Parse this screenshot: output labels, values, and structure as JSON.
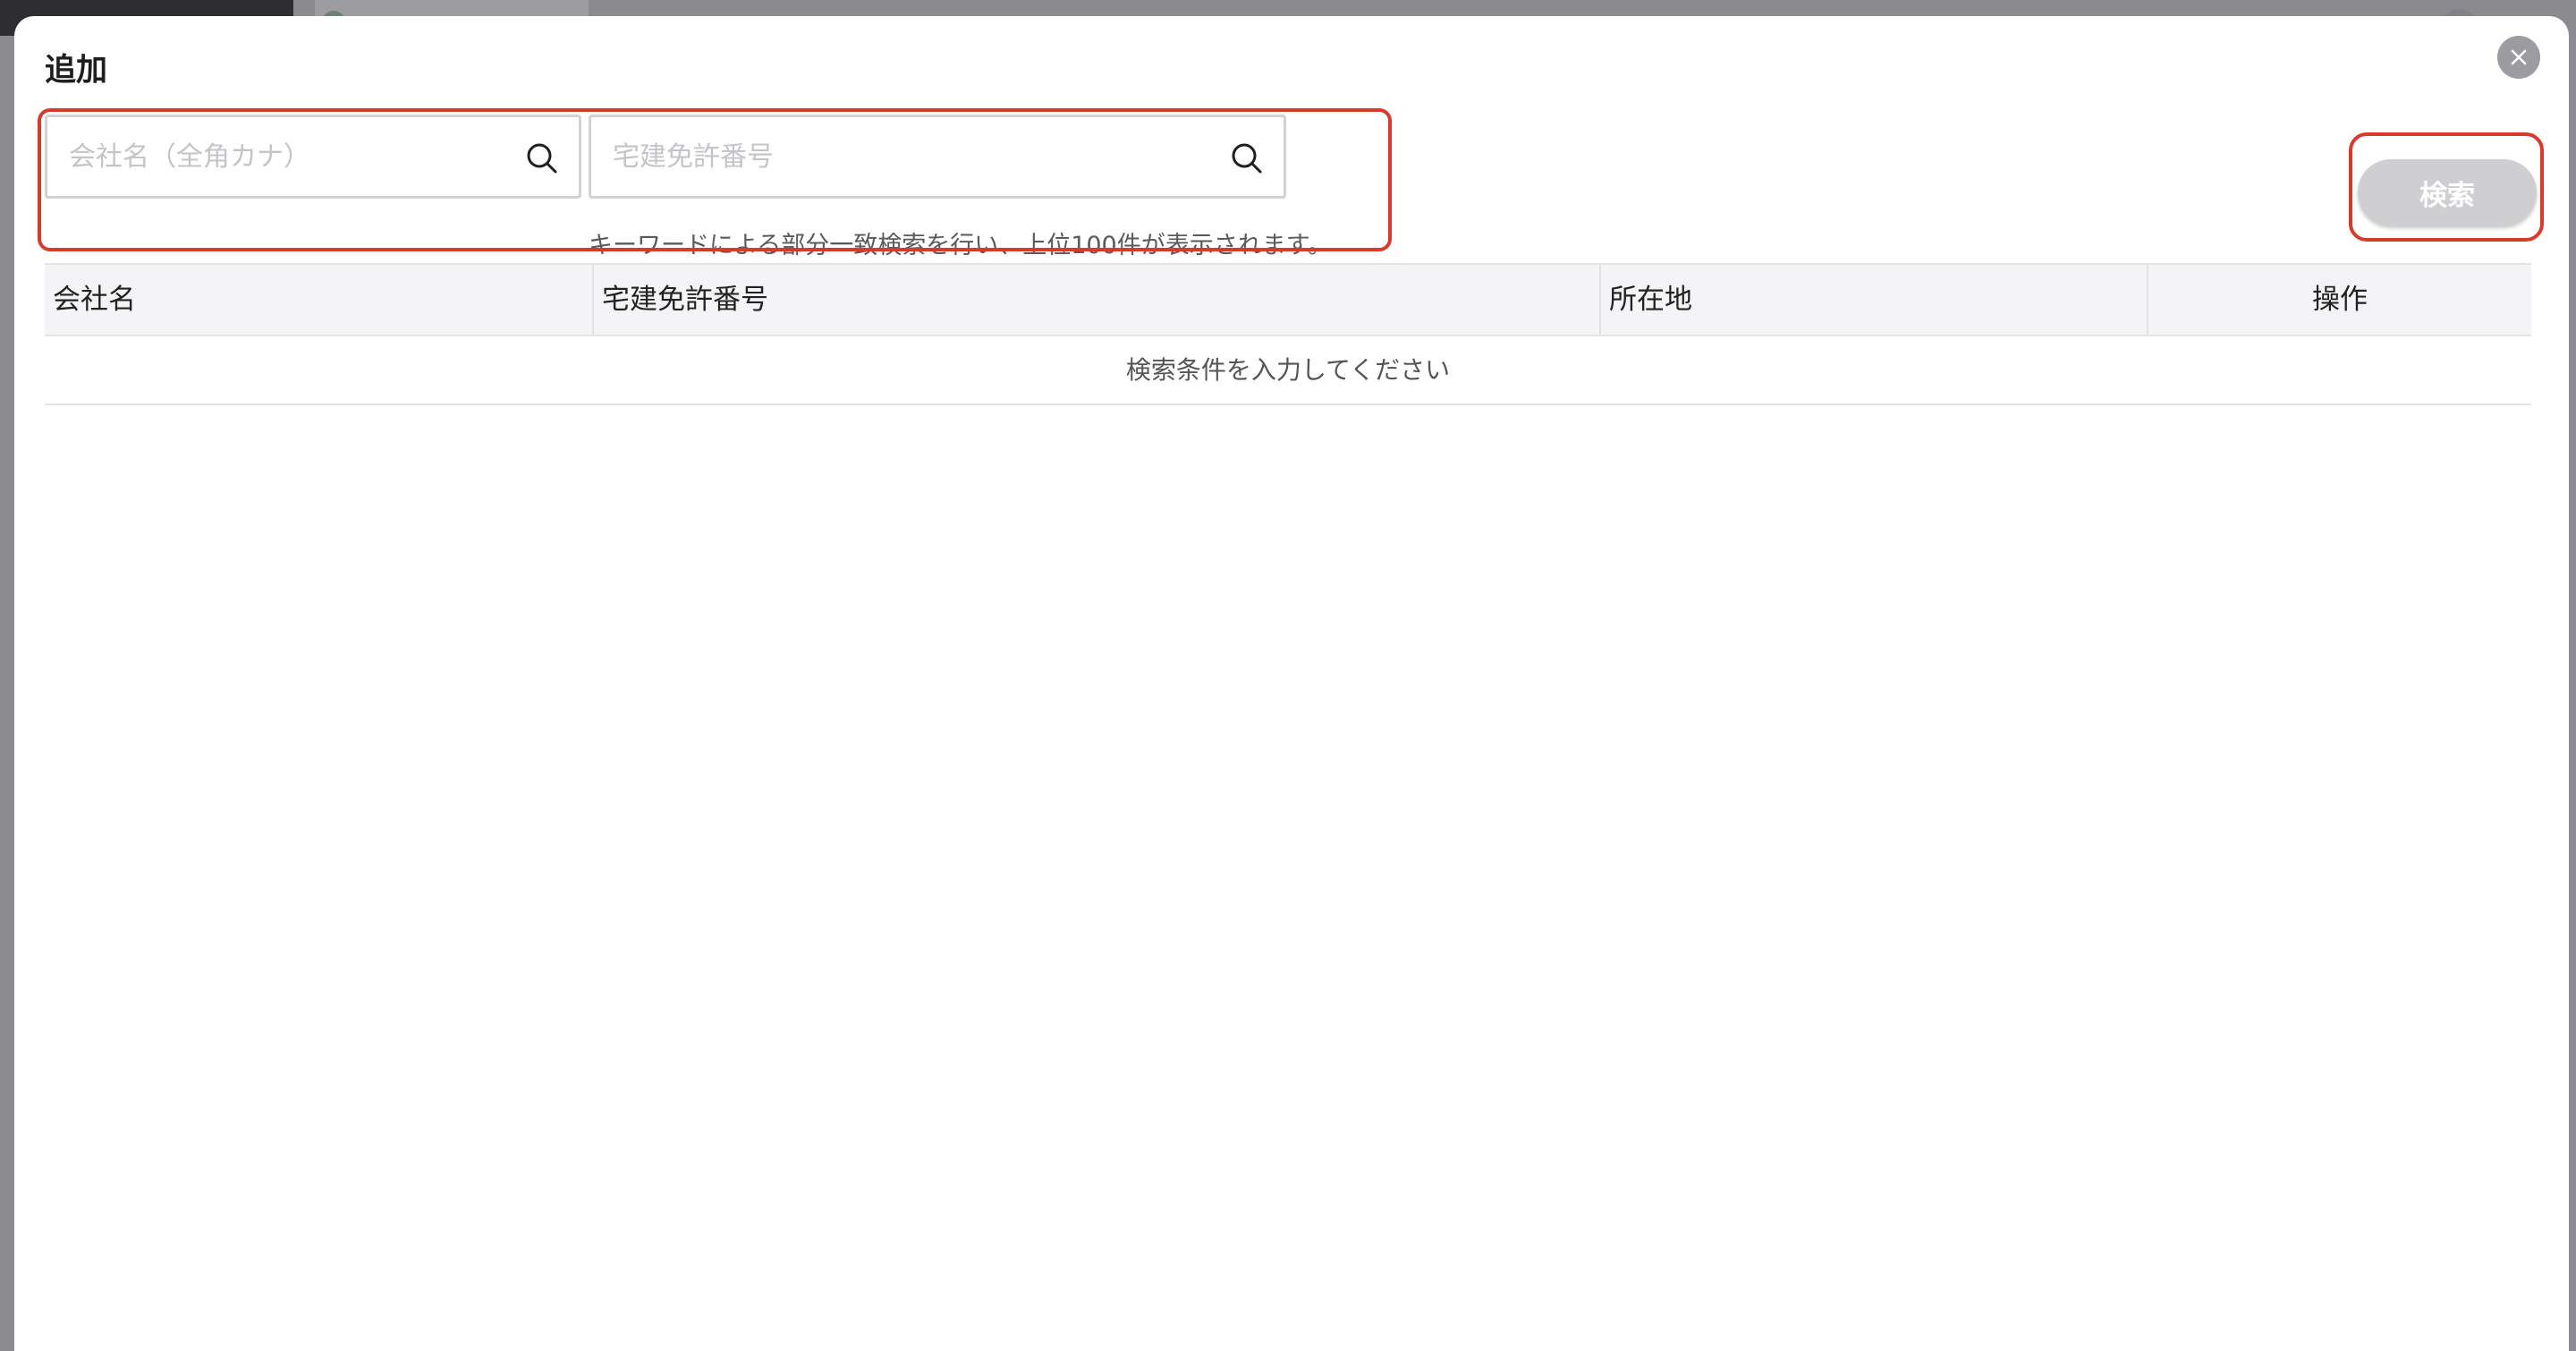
{
  "modal": {
    "title": "追加",
    "close_icon": "close-icon"
  },
  "search": {
    "company_name_placeholder": "会社名（全角カナ）",
    "license_number_placeholder": "宅建免許番号",
    "hint": "キーワードによる部分一致検索を行い、上位100件が表示されます。",
    "search_button_label": "検索",
    "search_icon": "search-icon"
  },
  "table": {
    "columns": [
      "会社名",
      "宅建免許番号",
      "所在地",
      "操作"
    ],
    "empty_message": "検索条件を入力してください"
  },
  "colors": {
    "annotation": "#d93a2b",
    "button_disabled": "#cfcfd2",
    "header_bg": "#f4f4f6"
  }
}
